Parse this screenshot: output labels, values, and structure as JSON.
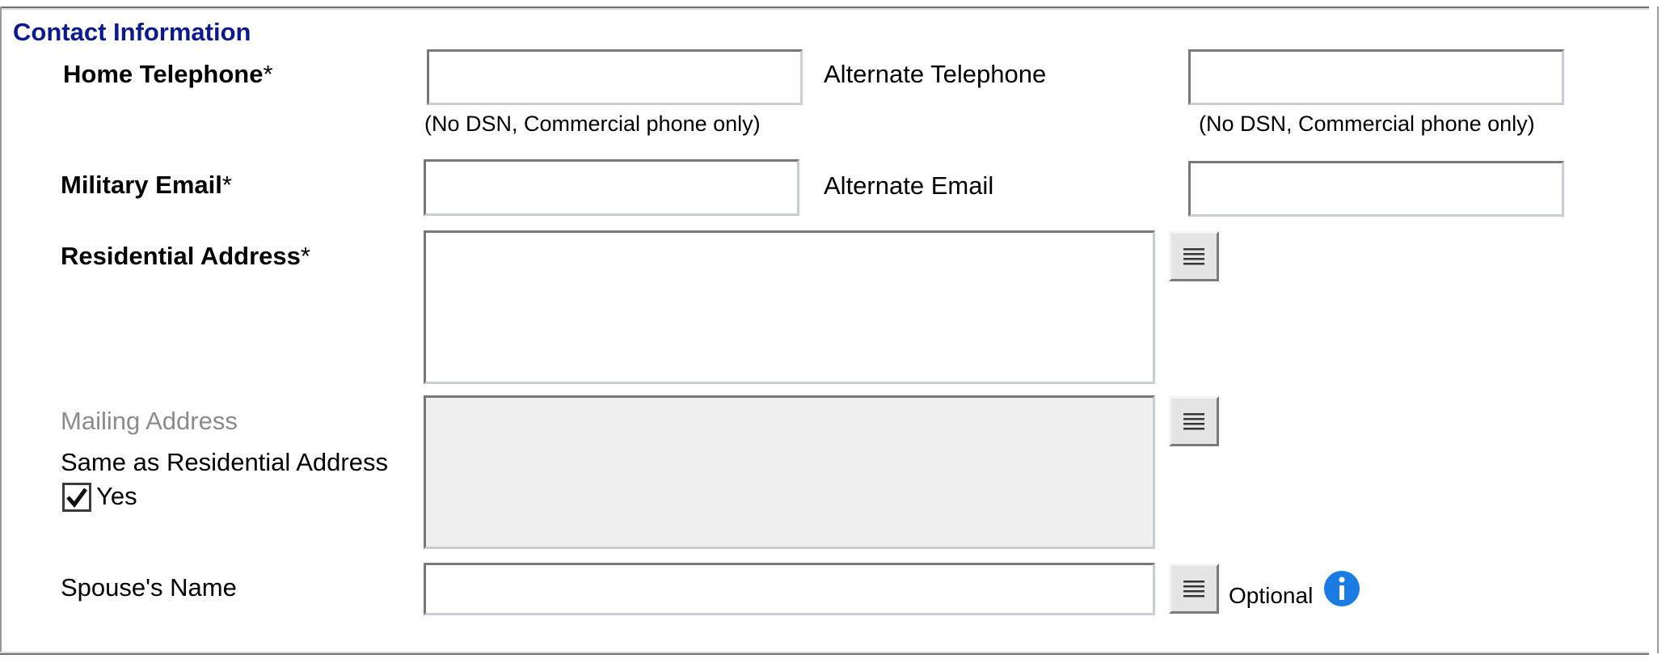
{
  "section": {
    "title": "Contact Information"
  },
  "home_telephone": {
    "label": "Home Telephone",
    "required_mark": "*",
    "value": "",
    "hint": "(No DSN, Commercial phone only)"
  },
  "alternate_telephone": {
    "label": "Alternate Telephone",
    "value": "",
    "hint": "(No DSN, Commercial phone only)"
  },
  "military_email": {
    "label": "Military Email",
    "required_mark": "*",
    "value": ""
  },
  "alternate_email": {
    "label": "Alternate Email",
    "value": ""
  },
  "residential_address": {
    "label": "Residential Address",
    "required_mark": "*",
    "value": "",
    "button_icon": "list-lines-icon"
  },
  "mailing_address": {
    "label": "Mailing Address",
    "same_as_label": "Same as Residential Address",
    "checkbox_label": "Yes",
    "checked": true,
    "value": "",
    "disabled": true,
    "button_icon": "list-lines-icon"
  },
  "spouse_name": {
    "label": "Spouse's Name",
    "value": "",
    "optional_label": "Optional",
    "button_icon": "list-lines-icon",
    "info_icon": "info-icon"
  },
  "colors": {
    "title": "#0b1a8c",
    "info": "#1a7be0",
    "disabled_label": "#8b8b8b",
    "disabled_field": "#efefef"
  }
}
